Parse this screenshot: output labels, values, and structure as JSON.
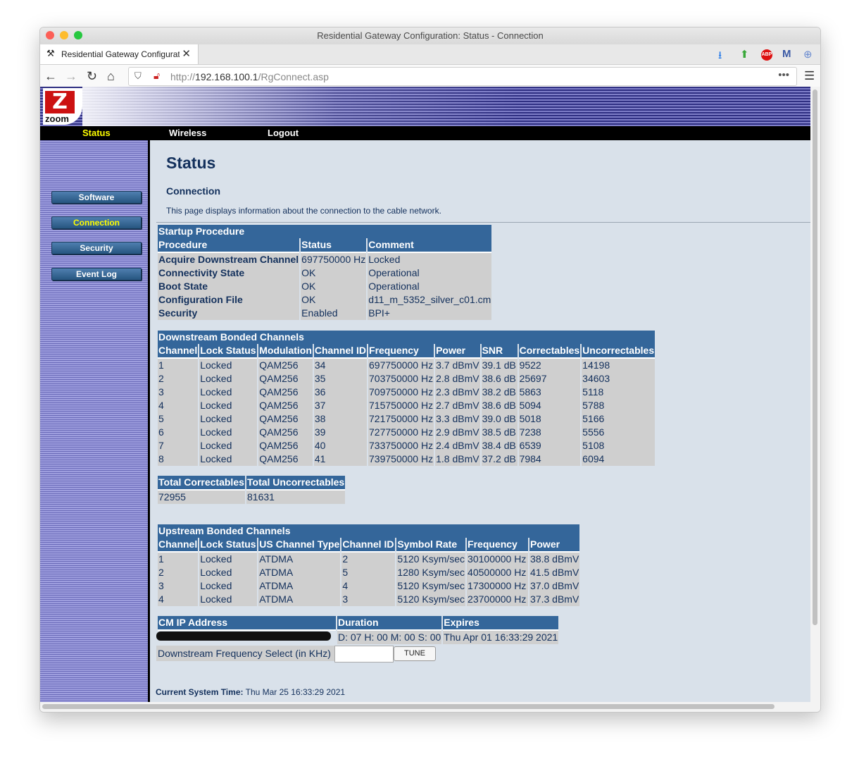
{
  "window": {
    "title": "Residential Gateway Configuration: Status - Connection"
  },
  "tab": {
    "title": "Residential Gateway Configuration: Status - Connection"
  },
  "url": {
    "prefix": "http://",
    "host": "192.168.100.1",
    "path": "/RgConnect.asp"
  },
  "brand": {
    "logo_text": "zoom"
  },
  "menu": {
    "status": "Status",
    "wireless": "Wireless",
    "logout": "Logout",
    "active_color": "#ffff00"
  },
  "sidebar": {
    "items": [
      "Software",
      "Connection",
      "Security",
      "Event Log"
    ],
    "active": "Connection"
  },
  "page": {
    "title": "Status",
    "subtitle": "Connection",
    "description": "This page displays information about the connection to the cable network."
  },
  "startup": {
    "caption": "Startup Procedure",
    "headers": [
      "Procedure",
      "Status",
      "Comment"
    ],
    "rows": [
      [
        "Acquire Downstream Channel",
        "697750000 Hz",
        "Locked"
      ],
      [
        "Connectivity State",
        "OK",
        "Operational"
      ],
      [
        "Boot State",
        "OK",
        "Operational"
      ],
      [
        "Configuration File",
        "OK",
        "d11_m_5352_silver_c01.cm"
      ],
      [
        "Security",
        "Enabled",
        "BPI+"
      ]
    ]
  },
  "downstream": {
    "caption": "Downstream Bonded Channels",
    "headers": [
      "Channel",
      "Lock Status",
      "Modulation",
      "Channel ID",
      "Frequency",
      "Power",
      "SNR",
      "Correctables",
      "Uncorrectables"
    ],
    "rows": [
      [
        "1",
        "Locked",
        "QAM256",
        "34",
        "697750000 Hz",
        "3.7 dBmV",
        "39.1 dB",
        "9522",
        "14198"
      ],
      [
        "2",
        "Locked",
        "QAM256",
        "35",
        "703750000 Hz",
        "2.8 dBmV",
        "38.6 dB",
        "25697",
        "34603"
      ],
      [
        "3",
        "Locked",
        "QAM256",
        "36",
        "709750000 Hz",
        "2.3 dBmV",
        "38.2 dB",
        "5863",
        "5118"
      ],
      [
        "4",
        "Locked",
        "QAM256",
        "37",
        "715750000 Hz",
        "2.7 dBmV",
        "38.6 dB",
        "5094",
        "5788"
      ],
      [
        "5",
        "Locked",
        "QAM256",
        "38",
        "721750000 Hz",
        "3.3 dBmV",
        "39.0 dB",
        "5018",
        "5166"
      ],
      [
        "6",
        "Locked",
        "QAM256",
        "39",
        "727750000 Hz",
        "2.9 dBmV",
        "38.5 dB",
        "7238",
        "5556"
      ],
      [
        "7",
        "Locked",
        "QAM256",
        "40",
        "733750000 Hz",
        "2.4 dBmV",
        "38.4 dB",
        "6539",
        "5108"
      ],
      [
        "8",
        "Locked",
        "QAM256",
        "41",
        "739750000 Hz",
        "1.8 dBmV",
        "37.2 dB",
        "7984",
        "6094"
      ]
    ]
  },
  "totals": {
    "headers": [
      "Total Correctables",
      "Total Uncorrectables"
    ],
    "values": [
      "72955",
      "81631"
    ]
  },
  "upstream": {
    "caption": "Upstream Bonded Channels",
    "headers": [
      "Channel",
      "Lock Status",
      "US Channel Type",
      "Channel ID",
      "Symbol Rate",
      "Frequency",
      "Power"
    ],
    "rows": [
      [
        "1",
        "Locked",
        "ATDMA",
        "2",
        "5120 Ksym/sec",
        "30100000 Hz",
        "38.8 dBmV"
      ],
      [
        "2",
        "Locked",
        "ATDMA",
        "5",
        "1280 Ksym/sec",
        "40500000 Hz",
        "41.5 dBmV"
      ],
      [
        "3",
        "Locked",
        "ATDMA",
        "4",
        "5120 Ksym/sec",
        "17300000 Hz",
        "37.0 dBmV"
      ],
      [
        "4",
        "Locked",
        "ATDMA",
        "3",
        "5120 Ksym/sec",
        "23700000 Hz",
        "37.3 dBmV"
      ]
    ]
  },
  "cmip": {
    "headers": [
      "CM IP Address",
      "Duration",
      "Expires"
    ],
    "duration": "D: 07 H: 00 M: 00 S: 00",
    "expires": "Thu Apr 01 16:33:29 2021"
  },
  "tune": {
    "label": "Downstream Frequency Select (in KHz)",
    "value": "",
    "button": "TUNE"
  },
  "system_time": {
    "label": "Current System Time:",
    "value": "Thu Mar 25 16:33:29 2021"
  }
}
